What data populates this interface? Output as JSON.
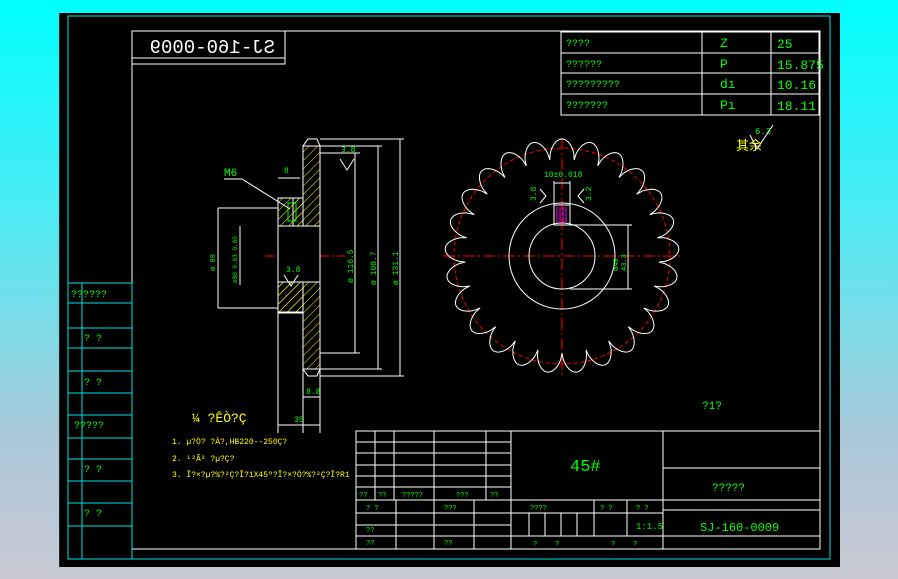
{
  "drawing_code_mirrored": "SJ-160-0009",
  "params": [
    {
      "label": "????",
      "sym": "Z",
      "val": "25"
    },
    {
      "label": "??????",
      "sym": "P",
      "val": "15.875"
    },
    {
      "label": "?????????",
      "sym": "dı",
      "val": "10.16"
    },
    {
      "label": "???????",
      "sym": "Pı",
      "val": "18.11"
    }
  ],
  "roughness": {
    "prefix": "其余",
    "value": "6.3"
  },
  "side_view": {
    "m6": "M6",
    "dim_8": "8",
    "dim_bore": "ø40",
    "dim_hub": "ø 80",
    "dim_hubtol": "ø80 0.03 0.00",
    "dim_116": "ø 116.5",
    "dim_108": "ø 108.7",
    "dim_131": "ø 131.1",
    "rough_top": "3.8",
    "rough_inner": "3.8",
    "dim_thk": "8.8",
    "dim_len": "35"
  },
  "front_view": {
    "key_width": "10±0.018",
    "rough_left": "3.8",
    "rough_right": "3.2",
    "dim_43": "43.3",
    "dim_40": "ø40"
  },
  "notes": {
    "title": "¼ ?ÊÒ?Ç",
    "lines": [
      "1. µ?Ò? ?À?,HB220--250Ç?",
      "2. ¹²Ã² ?µ?Ç?",
      "3. Î?×?µ?%?²Ç?Î?1X45º?Î?×?Ó?%?²Ç?Î?R1"
    ]
  },
  "misc_mark": "?1?",
  "left_panel": [
    "??????",
    "? ?",
    "? ?",
    "?????",
    "? ?",
    "? ?"
  ],
  "title_block": {
    "material": "45#",
    "name": "?????",
    "code": "SJ-160-0009",
    "scale": "1:1.5",
    "grid_row5": [
      "??",
      "??",
      "?????",
      "???",
      "??"
    ],
    "grid_row6": [
      "? ?",
      "???"
    ],
    "grid_row7": [
      "??"
    ],
    "grid_row8": [
      "??",
      "??"
    ],
    "center_row1": [
      "????",
      "? ?",
      "? ?"
    ],
    "center_row3": [
      "?",
      "?",
      "?",
      "?"
    ]
  }
}
